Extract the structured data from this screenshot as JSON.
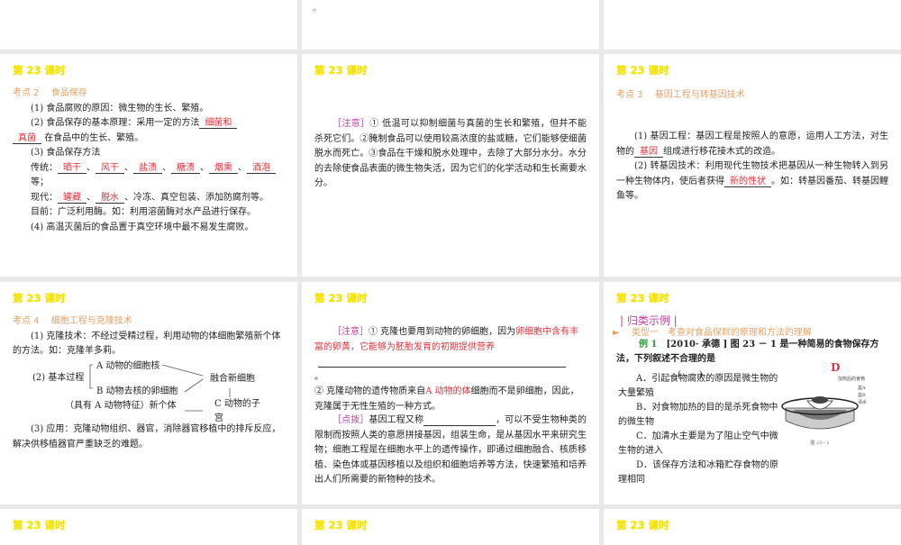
{
  "header": "第 23 课时",
  "top_dot": "。",
  "s2": {
    "title": "考点 2　 食品保存",
    "l1": "(1) 食品腐败的原因：微生物的生长、繁殖。",
    "l2a": "(2) 食品保存的基本原理：采用一定的方法",
    "b1": "细菌和",
    "b2": "真菌",
    "l2b": "在食品中的生长、繁殖。",
    "l3": "(3) 食品保存方法",
    "trad_label": "传统：",
    "trad": [
      "晒干",
      "风干",
      "盐渍",
      "糖渍",
      "烟熏",
      "酒泡"
    ],
    "etc": "等；",
    "mod_label": "现代：",
    "mod": [
      "罐藏",
      "脱水"
    ],
    "mod_rest": "、冷冻、真空包装、添加防腐剂等。",
    "now": "目前：广泛利用酶。如：利用溶菌酶对水产品进行保存。",
    "l4": "(4) 高温灭菌后的食品置于真空环境中最不易发生腐败。"
  },
  "note1": {
    "tag": "［注意］",
    "text": "① 低温可以抑制细菌与真菌的生长和繁殖，但并不能杀死它们。②腌制食品可以使用较高浓度的盐或糖，它们能够使细菌脱水而死亡。③食品在干燥和脱水处理中，去除了大部分水分。水分的去除使食品表面的微生物失活，因为它们的化学活动和生长需要水分。"
  },
  "s3": {
    "title": "考点 3　 基因工程与转基因技术",
    "l1a": "(1) 基因工程：基因工程是按照人的意愿，运用人工方法，对生物的",
    "b1": "基因",
    "l1b": "组成进行移花接木式的改造。",
    "l2a": "(2) 转基因技术：利用现代生物技术把基因从一种生物转入到另一种生物体内，使后者获得",
    "b2": "新的性状",
    "l2b": "。如：转基因番茄、转基因鲤鱼等。"
  },
  "s4": {
    "title": "考点 4　 细胞工程与克隆技术",
    "l1": "(1) 克隆技术：不经过受精过程，利用动物的体细胞繁殖新个体的方法。如：克隆羊多莉。",
    "proc": "(2) 基本过程",
    "a": "A 动物的细胞核",
    "b": "B 动物去核的卵细胞",
    "fuse": "融合新细胞",
    "newind": "（具有 A 动物特征）新个体",
    "c": "C 动物的子宫",
    "l3": "(3) 应用：克隆动物组织、器官，消除器官移植中的排斥反应，解决供移植器官严重缺乏的难题。"
  },
  "note2": {
    "tag": "［注意］",
    "t1": "① 克隆也要用到动物的卵细胞，因为",
    "b1": "卵细胞中含有丰富的卵黄，它能够为胚胎发育的初期提供营养",
    "dot": "。",
    "t2": "② 克隆动物的遗传物质来自",
    "b2": "A 动物的体",
    "t2b": "细胞而不是卵细胞，因此，克隆属于无性生殖的一种方式。",
    "tag2": "［点拨］",
    "t3": "基因工程又称",
    "t3b": "，可以不受生物种类的限制而按照人类的意愿拼接基因，组装生命，是从基因水平来研究生物；细胞工程是在细胞水平上的遗传操作，即通过细胞融合、核质移植、染色体或基因移植以及组织和细胞培养等方法，快速繁殖和培养出人们所需要的新物种的技术。"
  },
  "ex": {
    "title": "| 归类示例 |",
    "type": "► 　类型一　考查对食品保鲜的原理和方法的理解",
    "label": "例 1",
    "q": "[2010· 承德 ] 图 23 － 1 是一种简易的食物保存方法，下列叙述不合理的是",
    "paren": "(　　)",
    "answer": "D",
    "opts": [
      "A．引起食物腐败的原因是微生物的大量繁殖",
      "B．对食物加热的目的是杀死食物中的微生物",
      "C．加清水主要是为了阻止空气中微生物的进入",
      "D．该保存方法和冰箱贮存食物的原理相同"
    ],
    "fig": {
      "food": "加热后的食物",
      "pa": "盆A",
      "pb": "盆B",
      "water": "清水",
      "caption": "图 23－1"
    }
  }
}
